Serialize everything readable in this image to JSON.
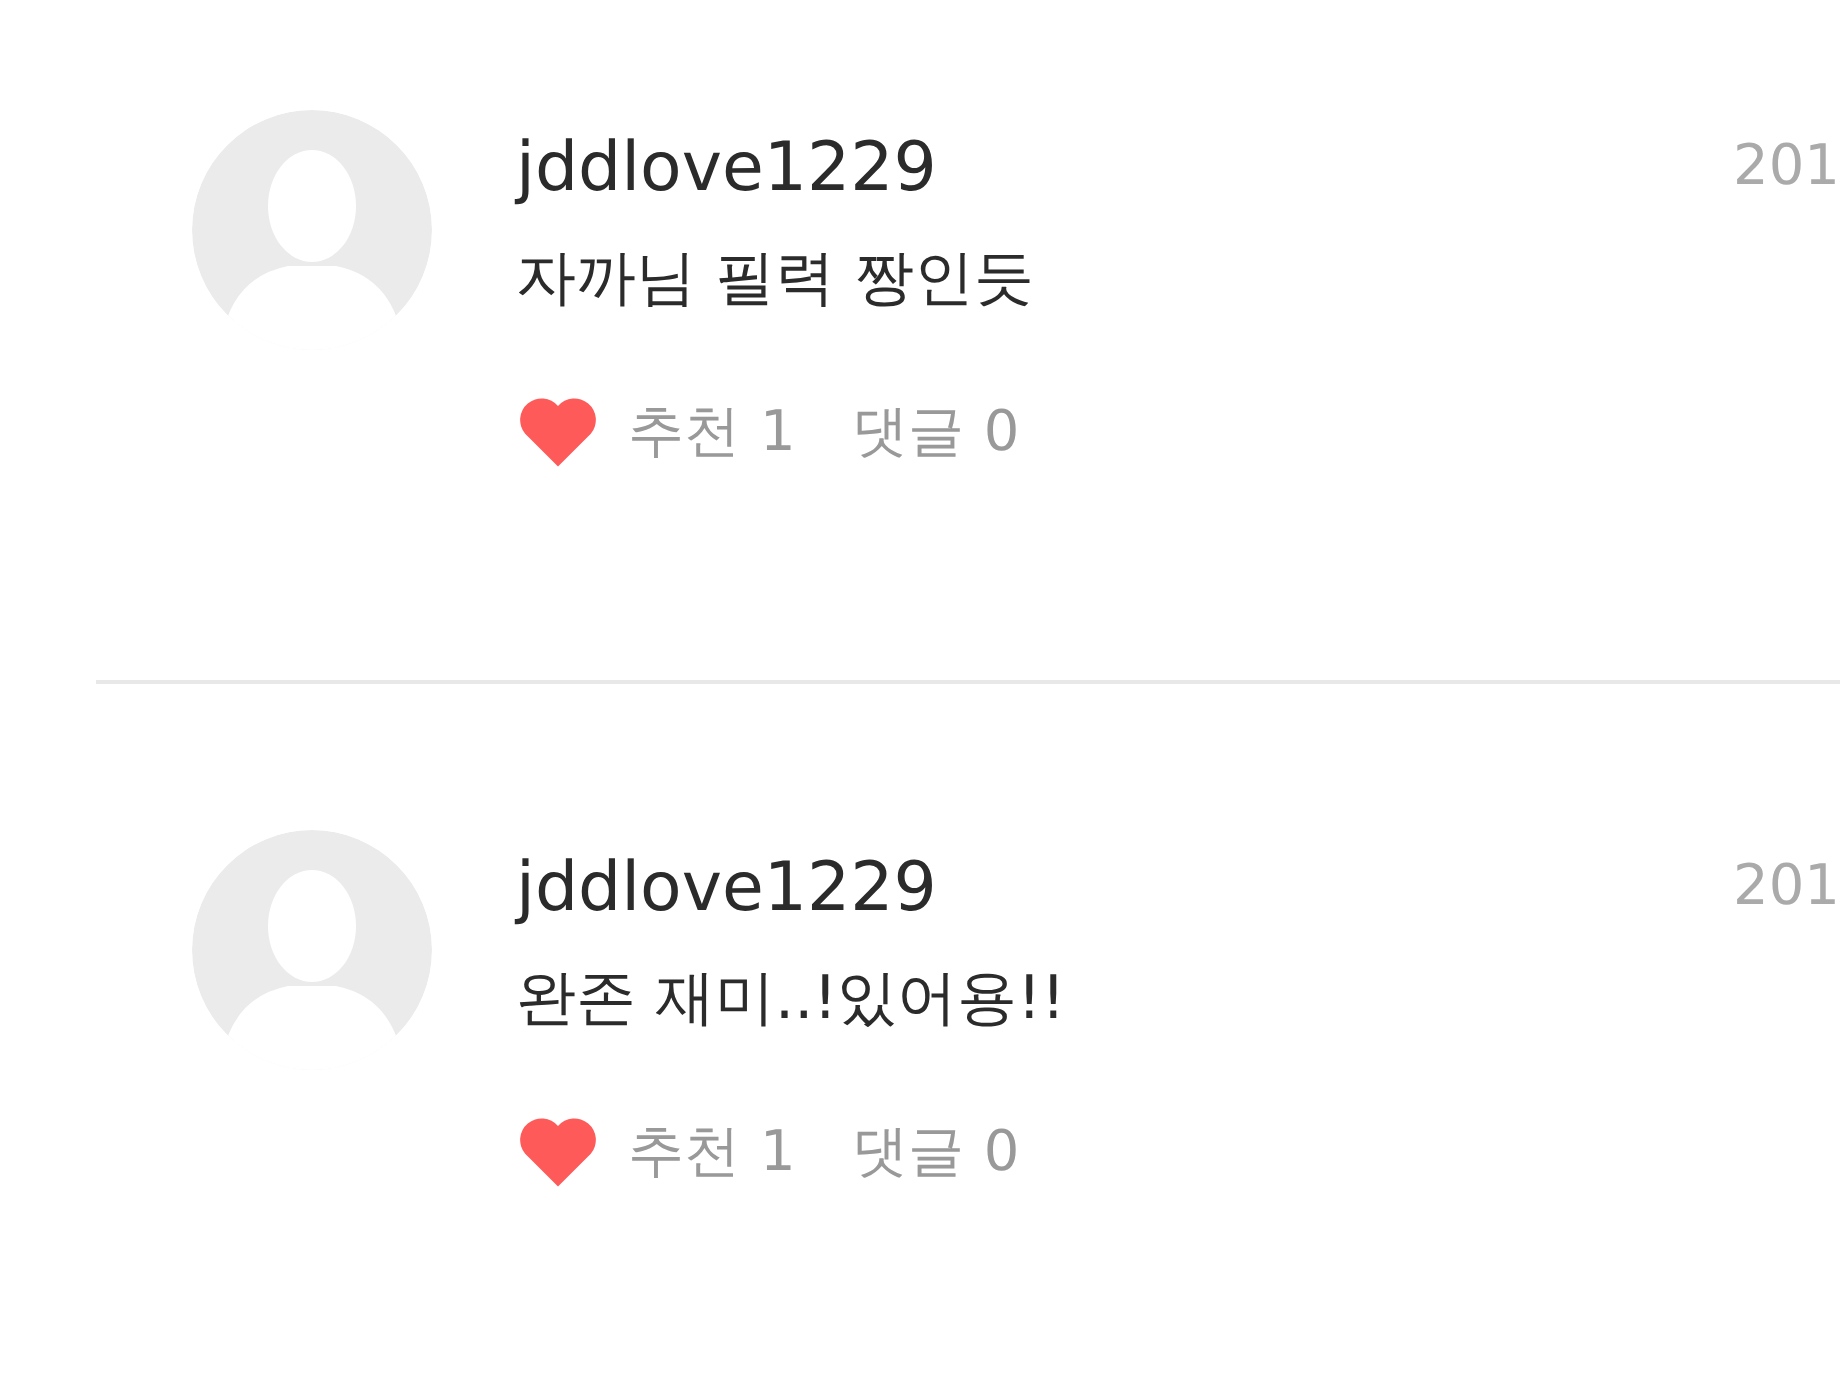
{
  "comments": [
    {
      "author": "jddlove1229",
      "date": "201",
      "text": "자까님 필력 짱인듯",
      "likes_label": "추천",
      "likes": "1",
      "replies_label": "댓글",
      "replies": "0"
    },
    {
      "author": "jddlove1229",
      "date": "201",
      "text": "완존 재미..!있어용!!",
      "likes_label": "추천",
      "likes": "1",
      "replies_label": "댓글",
      "replies": "0"
    }
  ]
}
